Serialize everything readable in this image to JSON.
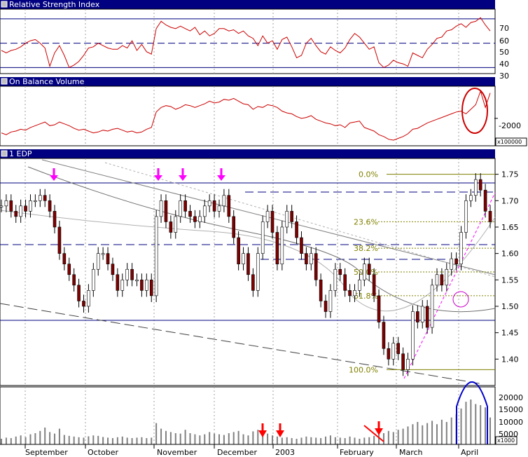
{
  "panels": {
    "rsi": {
      "title": "Relative Strength Index",
      "ticks": [
        "70",
        "60",
        "50",
        "40",
        "30"
      ]
    },
    "obv": {
      "title": "On Balance Volume",
      "ticks": [
        "-2000"
      ],
      "unit": "x100000"
    },
    "price": {
      "title": "1 EDP",
      "ticks": [
        "1.75",
        "1.70",
        "1.65",
        "1.60",
        "1.55",
        "1.50",
        "1.45",
        "1.40"
      ]
    },
    "volume": {
      "ticks": [
        "20000",
        "15000",
        "10000",
        "5000"
      ],
      "unit": "x1000"
    }
  },
  "months": [
    "September",
    "October",
    "November",
    "December",
    "2003",
    "February",
    "March",
    "April"
  ],
  "fibonacci": [
    {
      "label": "0.0%",
      "value": 1.75
    },
    {
      "label": "23.6%",
      "value": 1.66
    },
    {
      "label": "38.2%",
      "value": 1.61
    },
    {
      "label": "50.0%",
      "value": 1.565
    },
    {
      "label": "61.8%",
      "value": 1.52
    },
    {
      "label": "100.0%",
      "value": 1.38
    }
  ],
  "colors": {
    "title_bar": "#000080",
    "grid": "#a0a0a0",
    "indicator": "#cc0000",
    "level": "#000080",
    "fib": "#808000",
    "marker": "#ff00ff",
    "volume": "#808080",
    "bull": "#ffffff",
    "bear": "#800000",
    "arrow": "#ff0000"
  },
  "chart_data": [
    {
      "type": "line",
      "title": "Relative Strength Index",
      "ylim": [
        25,
        78
      ],
      "reference_lines": [
        70,
        50,
        30
      ],
      "series": [
        {
          "values": [
            44,
            42,
            44,
            45,
            47,
            50,
            52,
            53,
            50,
            46,
            31,
            42,
            48,
            40,
            30,
            32,
            35,
            40,
            46,
            47,
            50,
            48,
            46,
            45,
            45,
            48,
            46,
            52,
            44,
            49,
            43,
            41,
            62,
            68,
            65,
            63,
            62,
            64,
            62,
            60,
            63,
            57,
            60,
            56,
            58,
            62,
            62,
            60,
            61,
            58,
            60,
            56,
            54,
            48,
            56,
            50,
            52,
            45,
            53,
            55,
            47,
            38,
            40,
            50,
            54,
            48,
            43,
            41,
            47,
            44,
            42,
            46,
            53,
            58,
            55,
            50,
            45,
            47,
            34,
            30,
            32,
            36,
            34,
            33,
            31,
            42,
            40,
            38,
            45,
            49,
            54,
            55,
            60,
            61,
            64,
            66,
            63,
            67,
            68,
            71,
            65,
            60
          ]
        }
      ]
    },
    {
      "type": "line",
      "title": "On Balance Volume",
      "series": [
        {
          "values": [
            -2160,
            -2180,
            -2150,
            -2140,
            -2120,
            -2130,
            -2100,
            -2080,
            -2060,
            -2040,
            -2080,
            -2070,
            -2040,
            -2060,
            -2080,
            -2110,
            -2130,
            -2120,
            -2140,
            -2160,
            -2150,
            -2130,
            -2140,
            -2120,
            -2110,
            -2130,
            -2150,
            -2140,
            -2160,
            -2150,
            -2120,
            -2100,
            -1930,
            -1880,
            -1860,
            -1870,
            -1900,
            -1880,
            -1850,
            -1860,
            -1880,
            -1860,
            -1840,
            -1810,
            -1830,
            -1820,
            -1790,
            -1800,
            -1780,
            -1810,
            -1840,
            -1850,
            -1900,
            -1870,
            -1880,
            -1850,
            -1860,
            -1880,
            -1920,
            -1940,
            -1950,
            -1980,
            -2000,
            -1990,
            -1970,
            -2010,
            -2030,
            -2050,
            -2060,
            -2080,
            -2070,
            -2100,
            -2050,
            -2040,
            -2030,
            -2100,
            -2120,
            -2140,
            -2180,
            -2200,
            -2230,
            -2240,
            -2220,
            -2200,
            -2170,
            -2120,
            -2110,
            -2080,
            -2050,
            -2030,
            -2010,
            -1990,
            -1970,
            -1950,
            -1930,
            -1920,
            -1950,
            -1900,
            -1850,
            -1700,
            -1880,
            -1720
          ]
        }
      ]
    },
    {
      "type": "candlestick",
      "title": "1 EDP",
      "ylim": [
        1.35,
        1.78
      ],
      "y_ticks": [
        1.75,
        1.7,
        1.65,
        1.6,
        1.55,
        1.5,
        1.45,
        1.4
      ],
      "close": [
        1.69,
        1.7,
        1.68,
        1.67,
        1.69,
        1.68,
        1.7,
        1.7,
        1.71,
        1.7,
        1.68,
        1.65,
        1.6,
        1.58,
        1.56,
        1.54,
        1.51,
        1.5,
        1.53,
        1.57,
        1.6,
        1.6,
        1.58,
        1.56,
        1.53,
        1.55,
        1.57,
        1.55,
        1.55,
        1.53,
        1.55,
        1.52,
        1.67,
        1.7,
        1.66,
        1.64,
        1.67,
        1.7,
        1.68,
        1.67,
        1.66,
        1.67,
        1.69,
        1.7,
        1.68,
        1.69,
        1.71,
        1.67,
        1.63,
        1.58,
        1.6,
        1.56,
        1.53,
        1.6,
        1.66,
        1.68,
        1.64,
        1.58,
        1.65,
        1.68,
        1.66,
        1.63,
        1.6,
        1.58,
        1.6,
        1.55,
        1.51,
        1.49,
        1.53,
        1.57,
        1.56,
        1.53,
        1.52,
        1.53,
        1.55,
        1.58,
        1.56,
        1.52,
        1.47,
        1.42,
        1.4,
        1.43,
        1.41,
        1.38,
        1.4,
        1.49,
        1.47,
        1.5,
        1.46,
        1.54,
        1.56,
        1.54,
        1.57,
        1.59,
        1.58,
        1.64,
        1.7,
        1.71,
        1.74,
        1.72,
        1.68,
        1.66
      ]
    },
    {
      "type": "bar",
      "title": "Volume",
      "ylim": [
        0,
        25000
      ],
      "values": [
        2500,
        3000,
        2800,
        3500,
        4000,
        3200,
        4500,
        5000,
        6000,
        7500,
        5500,
        4800,
        7000,
        4200,
        3800,
        3500,
        3200,
        3000,
        3600,
        4000,
        3800,
        3300,
        3000,
        2800,
        3200,
        3500,
        3000,
        2800,
        3000,
        3200,
        2800,
        3000,
        9500,
        7000,
        6000,
        5500,
        5000,
        4800,
        6500,
        5000,
        4500,
        4000,
        4500,
        5500,
        4800,
        4500,
        4200,
        5000,
        5500,
        6000,
        4500,
        4000,
        5800,
        6500,
        5200,
        4800,
        4000,
        3500,
        3000,
        3200,
        2800,
        2500,
        3000,
        3500,
        3200,
        3000,
        2800,
        3500,
        4000,
        3200,
        3000,
        2800,
        3500,
        3000,
        2500,
        3000,
        3200,
        3800,
        4500,
        5000,
        6000,
        5500,
        6500,
        7000,
        8000,
        9000,
        10000,
        8500,
        9500,
        10500,
        9000,
        11000,
        10000,
        12000,
        13500,
        16000,
        19000,
        20000,
        18000,
        17500,
        16500,
        12000
      ]
    }
  ]
}
